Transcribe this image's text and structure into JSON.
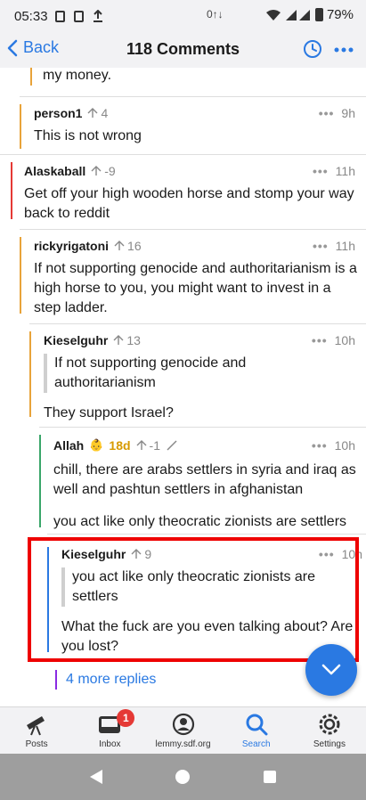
{
  "status_bar": {
    "time": "05:33",
    "network": "0↑↓",
    "battery": "79%"
  },
  "header": {
    "back_label": "Back",
    "title": "118 Comments"
  },
  "comments": [
    {
      "text": "my money."
    },
    {
      "author": "person1",
      "score": "4",
      "time": "9h",
      "text": "This is not wrong"
    },
    {
      "author": "Alaskaball",
      "score": "-9",
      "time": "11h",
      "text": "Get off your high wooden horse and stomp your way back to reddit"
    },
    {
      "author": "rickyrigatoni",
      "score": "16",
      "time": "11h",
      "text": "If not supporting genocide and authoritarianism is a high horse to you, you might want to invest in a step ladder."
    },
    {
      "author": "Kieselguhr",
      "score": "13",
      "time": "10h",
      "quote": "If not supporting genocide and authoritarianism",
      "text": "They support Israel?"
    },
    {
      "author": "Allah",
      "badge": "18d",
      "score": "-1",
      "time": "10h",
      "text": "chill, there are arabs settlers in syria and iraq as well and pashtun settlers in afghanistan",
      "text2": "you act like only theocratic zionists are settlers"
    },
    {
      "author": "Kieselguhr",
      "score": "9",
      "time": "10h",
      "quote": "you act like only theocratic zionists are settlers",
      "text": "What the fuck are you even talking about? Are you lost?"
    }
  ],
  "more_replies": "4 more replies",
  "bottom_nav": [
    {
      "label": "Posts",
      "icon": "telescope-icon"
    },
    {
      "label": "Inbox",
      "icon": "inbox-icon",
      "badge": "1"
    },
    {
      "label": "lemmy.sdf.org",
      "icon": "account-icon"
    },
    {
      "label": "Search",
      "icon": "search-icon",
      "active": true
    },
    {
      "label": "Settings",
      "icon": "gear-icon"
    }
  ],
  "colors": {
    "accent": "#2a79e2",
    "thread_orange": "#e8a33a",
    "thread_red": "#e53935",
    "thread_green": "#3aa66a",
    "thread_blue": "#2a79e2",
    "thread_purple": "#8a2be2",
    "highlight": "#ee0000"
  }
}
